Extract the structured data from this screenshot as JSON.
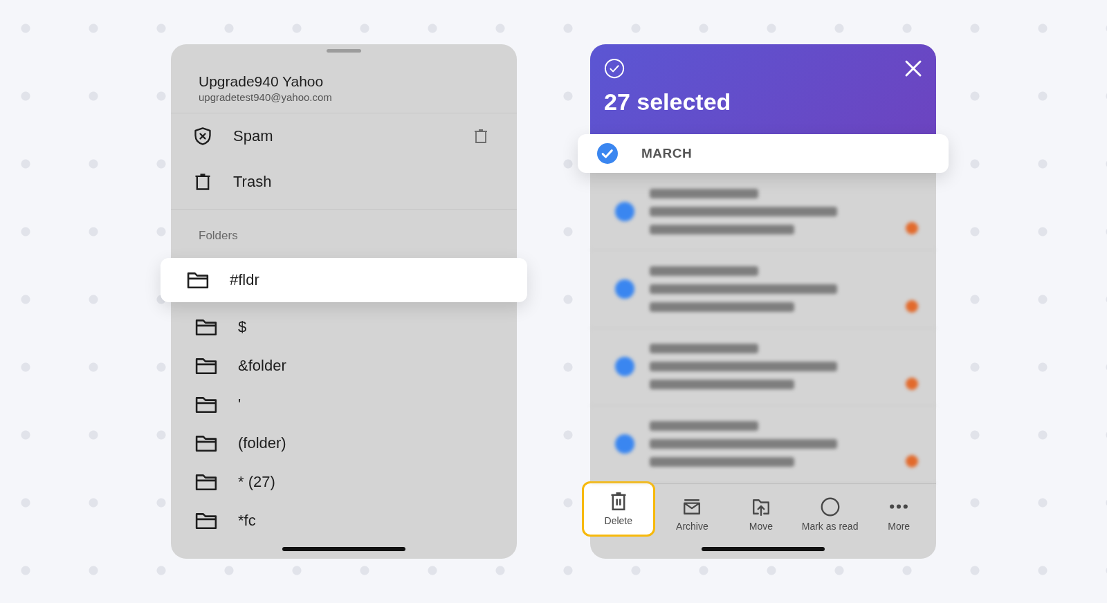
{
  "folder_sheet": {
    "account": {
      "name": "Upgrade940 Yahoo",
      "email": "upgradetest940@yahoo.com"
    },
    "system_folders": [
      {
        "label": "Spam",
        "kind": "spam",
        "empty_button": true
      },
      {
        "label": "Trash",
        "kind": "trash",
        "empty_button": false
      }
    ],
    "section_label": "Folders",
    "folders": [
      {
        "label": "#fldr",
        "selected": true
      },
      {
        "label": "$",
        "selected": false
      },
      {
        "label": "&folder",
        "selected": false
      },
      {
        "label": "'",
        "selected": false
      },
      {
        "label": "(folder)",
        "selected": false
      },
      {
        "label": "* (27)",
        "selected": false
      },
      {
        "label": "*fc",
        "selected": false
      }
    ]
  },
  "selection_screen": {
    "title": "27 selected",
    "group": {
      "label": "MARCH",
      "checked": true
    },
    "messages": [
      {
        "selected": true,
        "flagged": true
      },
      {
        "selected": true,
        "flagged": true
      },
      {
        "selected": true,
        "flagged": true
      },
      {
        "selected": true,
        "flagged": true
      }
    ],
    "toolbar": [
      {
        "label": "Delete",
        "kind": "delete",
        "selected": true
      },
      {
        "label": "Archive",
        "kind": "archive",
        "selected": false
      },
      {
        "label": "Move",
        "kind": "move",
        "selected": false
      },
      {
        "label": "Mark as read",
        "kind": "mark-read",
        "selected": false
      },
      {
        "label": "More",
        "kind": "more",
        "selected": false
      }
    ]
  }
}
